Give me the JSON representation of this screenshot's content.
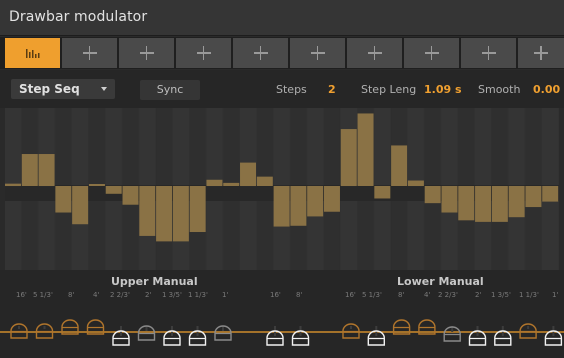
{
  "window": {
    "title": "Drawbar modulator"
  },
  "slots": [
    {
      "kind": "graph",
      "icon": "bar-graph-icon",
      "active": true
    },
    {
      "kind": "add",
      "icon": "plus-icon"
    },
    {
      "kind": "add",
      "icon": "plus-icon"
    },
    {
      "kind": "add",
      "icon": "plus-icon"
    },
    {
      "kind": "add",
      "icon": "plus-icon"
    },
    {
      "kind": "add",
      "icon": "plus-icon"
    },
    {
      "kind": "add",
      "icon": "plus-icon"
    },
    {
      "kind": "add",
      "icon": "plus-icon"
    },
    {
      "kind": "add",
      "icon": "plus-icon"
    },
    {
      "kind": "add",
      "icon": "plus-icon"
    }
  ],
  "controls": {
    "mode": "Step Seq",
    "sync": "Sync",
    "steps_label": "Steps",
    "steps_value": "2",
    "step_length_label": "Step Leng",
    "step_length_value": "1.09 s",
    "smooth_label": "Smooth",
    "smooth_value": "0.00"
  },
  "colors": {
    "accent": "#ef9f2e",
    "bar": "#8a7245",
    "value": "#f0a030"
  },
  "sequence": [
    0.03,
    0.41,
    0.41,
    -0.34,
    -0.49,
    0.02,
    -0.1,
    -0.24,
    -0.64,
    -0.71,
    -0.71,
    -0.59,
    0.08,
    0.04,
    0.3,
    0.12,
    -0.52,
    -0.51,
    -0.39,
    -0.33,
    0.73,
    0.93,
    -0.16,
    0.52,
    0.07,
    -0.22,
    -0.34,
    -0.44,
    -0.46,
    -0.46,
    -0.4,
    -0.27,
    -0.2
  ],
  "manuals": {
    "upper": {
      "label": "Upper Manual",
      "footages": [
        "16'",
        "5 1/3'",
        "8'",
        "4'",
        "2 2/3'",
        "2'",
        "1 3/5'",
        "1 1/3'",
        "1'"
      ],
      "levels": [
        0.2,
        0.2,
        0.0,
        0.0,
        0.55,
        0.3,
        0.55,
        0.55,
        0.3
      ]
    },
    "middle": {
      "footages": [
        "16'",
        "8'"
      ],
      "levels": [
        0.55,
        0.55
      ]
    },
    "lower": {
      "label": "Lower Manual",
      "footages": [
        "16'",
        "5 1/3'",
        "8'",
        "4'",
        "2 2/3'",
        "2'",
        "1 3/5'",
        "1 1/3'",
        "1'"
      ],
      "levels": [
        0.2,
        0.55,
        0.0,
        0.0,
        0.35,
        0.55,
        0.55,
        0.2,
        0.55
      ]
    }
  }
}
